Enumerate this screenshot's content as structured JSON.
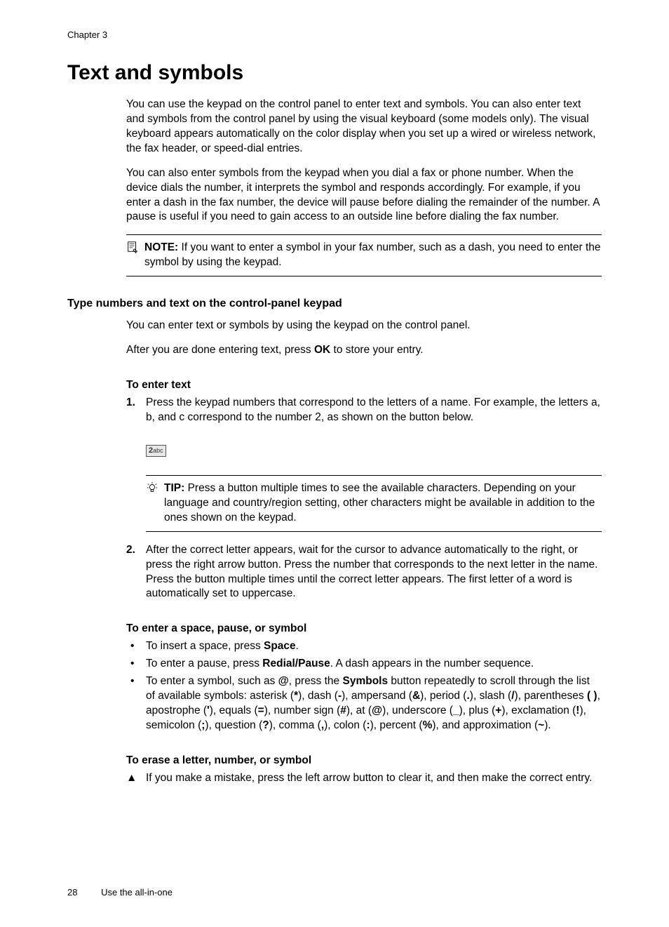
{
  "chapter": "Chapter 3",
  "title": "Text and symbols",
  "intro_p1": "You can use the keypad on the control panel to enter text and symbols. You can also enter text and symbols from the control panel by using the visual keyboard (some models only). The visual keyboard appears automatically on the color display when you set up a wired or wireless network, the fax header, or speed-dial entries.",
  "intro_p2": "You can also enter symbols from the keypad when you dial a fax or phone number. When the device dials the number, it interprets the symbol and responds accordingly. For example, if you enter a dash in the fax number, the device will pause before dialing the remainder of the number. A pause is useful if you need to gain access to an outside line before dialing the fax number.",
  "note_label": "NOTE:",
  "note_text": "If you want to enter a symbol in your fax number, such as a dash, you need to enter the symbol by using the keypad.",
  "section_heading": "Type numbers and text on the control-panel keypad",
  "section_p1": "You can enter text or symbols by using the keypad on the control panel.",
  "section_p2_pre": "After you are done entering text, press ",
  "section_p2_bold": "OK",
  "section_p2_post": " to store your entry.",
  "sub_enter_text": "To enter text",
  "step1_marker": "1.",
  "step1_text": "Press the keypad numbers that correspond to the letters of a name. For example, the letters a, b, and c correspond to the number 2, as shown on the button below.",
  "keypad_2": "2",
  "keypad_abc": "abc",
  "tip_label": "TIP:",
  "tip_text": "Press a button multiple times to see the available characters. Depending on your language and country/region setting, other characters might be available in addition to the ones shown on the keypad.",
  "step2_marker": "2.",
  "step2_text": "After the correct letter appears, wait for the cursor to advance automatically to the right, or press the right arrow button. Press the number that corresponds to the next letter in the name. Press the button multiple times until the correct letter appears. The first letter of a word is automatically set to uppercase.",
  "sub_space": "To enter a space, pause, or symbol",
  "bullet1_pre": "To insert a space, press ",
  "bullet1_bold": "Space",
  "bullet1_post": ".",
  "bullet2_pre": "To enter a pause, press ",
  "bullet2_bold": "Redial/Pause",
  "bullet2_post": ". A dash appears in the number sequence.",
  "bullet3_a": "To enter a symbol, such as ",
  "bullet3_at1": "@",
  "bullet3_b": ", press the ",
  "bullet3_symbols": "Symbols",
  "bullet3_c": " button repeatedly to scroll through the list of available symbols: asterisk (",
  "bullet3_asterisk": "*",
  "bullet3_d": "), dash (",
  "bullet3_dash": "-",
  "bullet3_e": "), ampersand (",
  "bullet3_amp": "&",
  "bullet3_f": "), period (",
  "bullet3_period": ".",
  "bullet3_g": "), slash (",
  "bullet3_slash": "/",
  "bullet3_h": "), parentheses ",
  "bullet3_parens": "( )",
  "bullet3_i": ", apostrophe (",
  "bullet3_apos": "'",
  "bullet3_j": "), equals (",
  "bullet3_equals": "=",
  "bullet3_k": "), number sign (",
  "bullet3_hash": "#",
  "bullet3_l": "), at (",
  "bullet3_at2": "@",
  "bullet3_m": "), underscore (",
  "bullet3_underscore": "_",
  "bullet3_n": "), plus (",
  "bullet3_plus": "+",
  "bullet3_o": "), exclamation (",
  "bullet3_excl": "!",
  "bullet3_p": "), semicolon (",
  "bullet3_semi": ";",
  "bullet3_q": "), question (",
  "bullet3_quest": "?",
  "bullet3_r": "), comma (",
  "bullet3_comma": ",",
  "bullet3_s": "), colon (",
  "bullet3_colon": ":",
  "bullet3_t": "), percent (",
  "bullet3_pct": "%",
  "bullet3_u": "), and approximation (",
  "bullet3_tilde": "~",
  "bullet3_v": ").",
  "sub_erase": "To erase a letter, number, or symbol",
  "triangle_marker": "▲",
  "erase_text": "If you make a mistake, press the left arrow button to clear it, and then make the correct entry.",
  "page_number": "28",
  "footer_title": "Use the all-in-one"
}
